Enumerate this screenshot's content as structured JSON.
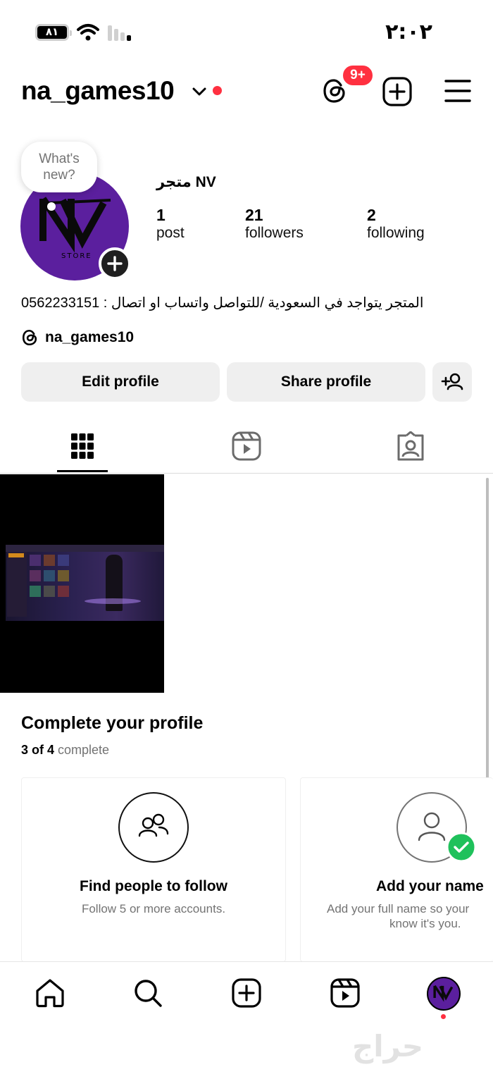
{
  "status_bar": {
    "battery": "٨١",
    "time": "٢:٠٢"
  },
  "header": {
    "username": "na_games10",
    "threads_badge": "9+"
  },
  "profile": {
    "bubble_text": "What's new?",
    "display_name": "متجر NV",
    "stats": [
      {
        "value": "1",
        "label": "post"
      },
      {
        "value": "21",
        "label": "followers"
      },
      {
        "value": "2",
        "label": "following"
      }
    ],
    "bio": "المتجر يتواجد في السعودية /للتواصل واتساب او اتصال : 0562233151",
    "threads_handle": "na_games10"
  },
  "buttons": {
    "edit": "Edit profile",
    "share": "Share profile"
  },
  "tabs": [
    "grid-icon",
    "reels-icon",
    "tagged-icon"
  ],
  "complete_profile": {
    "title": "Complete your profile",
    "progress_bold": "3 of 4",
    "progress_rest": "complete",
    "progress_fraction": 0.75,
    "cards": [
      {
        "title": "Find people to follow",
        "desc": [
          "Follow 5 or more accounts."
        ],
        "icon": "people-icon",
        "done": false
      },
      {
        "title": "Add your name",
        "desc": [
          "Add your full name so your",
          "know it's you."
        ],
        "icon": "person-icon",
        "done": true
      }
    ]
  },
  "nav": [
    "home-icon",
    "search-icon",
    "create-icon",
    "reels-icon",
    "profile-avatar"
  ],
  "watermark": "حراج",
  "colors": {
    "notification_red": "#ff3040",
    "button_gray": "#efefef",
    "secondary_text": "#737373",
    "avatar_purple": "#5b1f9e",
    "check_green": "#1fc15b"
  }
}
